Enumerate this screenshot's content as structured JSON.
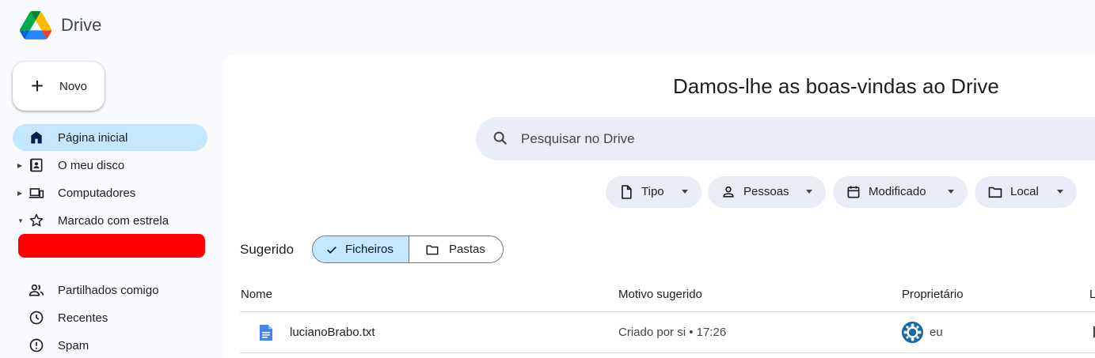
{
  "app": {
    "name": "Drive",
    "logo_icon": "google-drive-logo"
  },
  "sidebar": {
    "new_button": {
      "label": "Novo",
      "icon": "plus-icon"
    },
    "items": [
      {
        "label": "Página inicial",
        "icon": "home-icon",
        "active": true
      },
      {
        "label": "O meu disco",
        "icon": "my-drive-icon",
        "expandable": true
      },
      {
        "label": "Computadores",
        "icon": "computers-icon",
        "expandable": true
      },
      {
        "label": "Marcado com estrela",
        "icon": "star-icon",
        "expanded": true
      },
      {
        "label": "Partilhados comigo",
        "icon": "shared-people-icon"
      },
      {
        "label": "Recentes",
        "icon": "clock-icon"
      },
      {
        "label": "Spam",
        "icon": "spam-icon"
      }
    ],
    "redacted_color": "#ff0000"
  },
  "main": {
    "welcome": "Damos-lhe as boas-vindas ao Drive",
    "search": {
      "placeholder": "Pesquisar no Drive",
      "value": ""
    },
    "filters": [
      {
        "label": "Tipo",
        "icon": "file-icon"
      },
      {
        "label": "Pessoas",
        "icon": "person-icon"
      },
      {
        "label": "Modificado",
        "icon": "calendar-icon"
      },
      {
        "label": "Local",
        "icon": "folder-icon"
      }
    ],
    "suggested_label": "Sugerido",
    "toggle": {
      "files": "Ficheiros",
      "folders": "Pastas",
      "selected": "Ficheiros"
    },
    "table": {
      "columns": [
        "Nome",
        "Motivo sugerido",
        "Proprietário",
        "L"
      ],
      "rows": [
        {
          "name": "lucianoBrabo.txt",
          "reason": "Criado por si • 17:26",
          "owner": "eu",
          "icon": "doc-file-icon"
        }
      ]
    }
  },
  "colors": {
    "accent": "#c2e7ff",
    "surface": "#e9eef6",
    "background": "#f8fafd"
  }
}
